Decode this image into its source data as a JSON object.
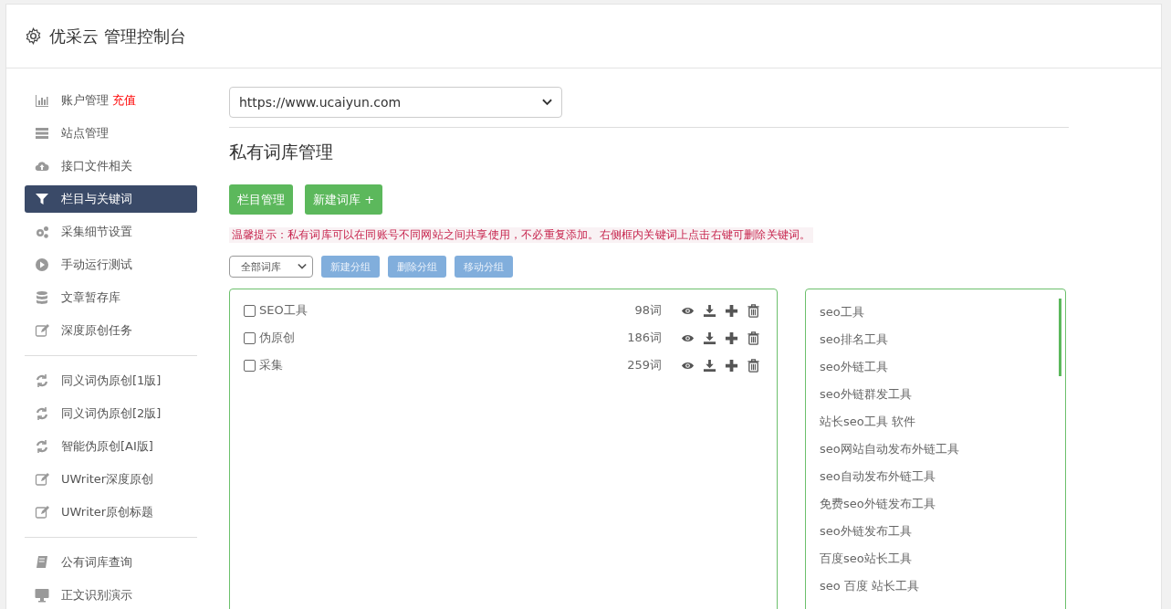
{
  "header": {
    "title": "优采云 管理控制台"
  },
  "sidebar": {
    "groups": [
      {
        "items": [
          {
            "kind": "chart",
            "label": "账户管理",
            "badge": "充值",
            "selected": false
          },
          {
            "kind": "server",
            "label": "站点管理",
            "selected": false
          },
          {
            "kind": "cloud",
            "label": "接口文件相关",
            "selected": false
          },
          {
            "kind": "filter",
            "label": "栏目与关键词",
            "selected": true
          },
          {
            "kind": "gears",
            "label": "采集细节设置",
            "selected": false
          },
          {
            "kind": "play",
            "label": "手动运行测试",
            "selected": false
          },
          {
            "kind": "database",
            "label": "文章暂存库",
            "selected": false
          },
          {
            "kind": "edit",
            "label": "深度原创任务",
            "selected": false
          }
        ]
      },
      {
        "items": [
          {
            "kind": "refresh",
            "label": "同义词伪原创[1版]",
            "selected": false
          },
          {
            "kind": "refresh",
            "label": "同义词伪原创[2版]",
            "selected": false
          },
          {
            "kind": "refresh",
            "label": "智能伪原创[AI版]",
            "selected": false
          },
          {
            "kind": "edit",
            "label": "UWriter深度原创",
            "selected": false
          },
          {
            "kind": "edit",
            "label": "UWriter原创标题",
            "selected": false
          }
        ]
      },
      {
        "items": [
          {
            "kind": "book",
            "label": "公有词库查询",
            "selected": false
          },
          {
            "kind": "monitor",
            "label": "正文识别演示",
            "selected": false
          }
        ]
      }
    ]
  },
  "site_select": {
    "value": "https://www.ucaiyun.com"
  },
  "section_title": "私有词库管理",
  "action_buttons": [
    "栏目管理",
    "新建词库 +"
  ],
  "tip": "温馨提示：私有词库可以在同账号不同网站之间共享使用，不必重复添加。右侧框内关键词上点击右键可删除关键词。",
  "filter_select": {
    "value": "全部词库"
  },
  "group_buttons": [
    "新建分组",
    "删除分组",
    "移动分组"
  ],
  "libraries": [
    {
      "name": "SEO工具",
      "count": "98词",
      "checked": false
    },
    {
      "name": "伪原创",
      "count": "186词",
      "checked": false
    },
    {
      "name": "采集",
      "count": "259词",
      "checked": false
    }
  ],
  "keywords": [
    "seo工具",
    "seo排名工具",
    "seo外链工具",
    "seo外链群发工具",
    "站长seo工具 软件",
    "seo网站自动发布外链工具",
    "seo自动发布外链工具",
    "免费seo外链发布工具",
    "seo外链发布工具",
    "百度seo站长工具",
    "seo 百度 站长工具"
  ]
}
